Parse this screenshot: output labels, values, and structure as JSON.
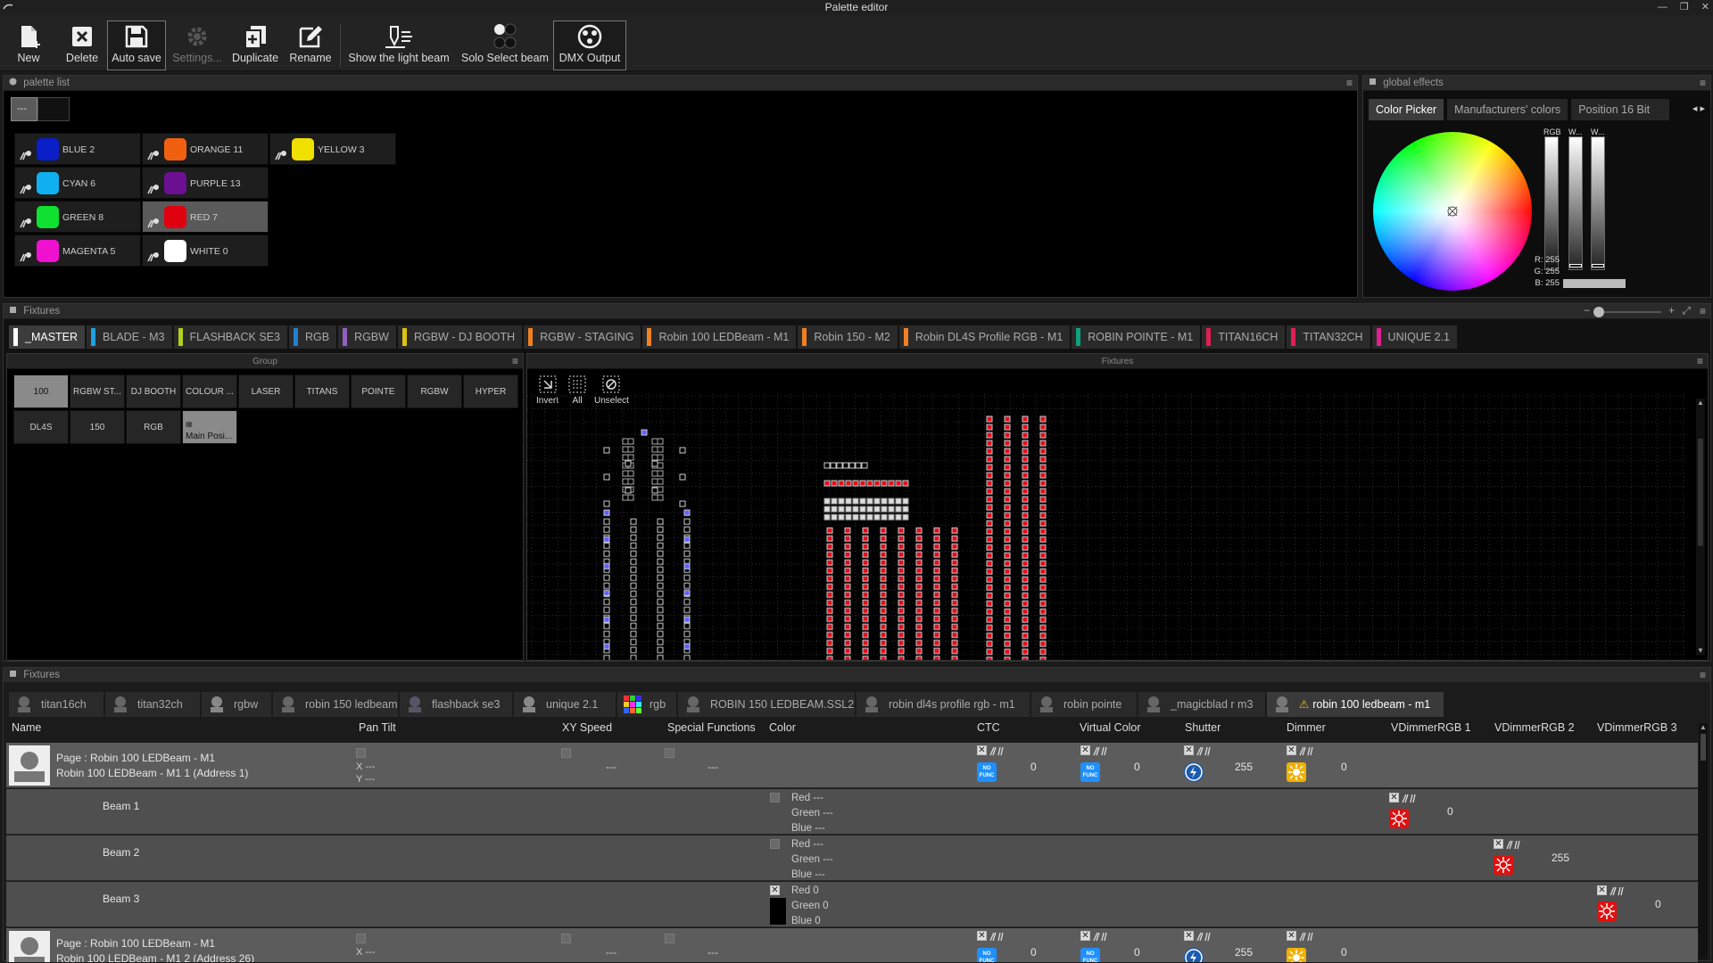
{
  "window": {
    "title": "Palette editor"
  },
  "toolbar": {
    "items": [
      {
        "label": "New"
      },
      {
        "label": "Delete"
      },
      {
        "label": "Auto save"
      },
      {
        "label": "Settings..."
      },
      {
        "label": "Duplicate"
      },
      {
        "label": "Rename"
      },
      {
        "label": "Show the light beam"
      },
      {
        "label": "Solo Select beam"
      },
      {
        "label": "DMX Output"
      }
    ]
  },
  "palette_list": {
    "title": "palette list",
    "tab_label": "---",
    "items": [
      {
        "name": "BLUE 2",
        "color": "#0a1fc8"
      },
      {
        "name": "ORANGE 11",
        "color": "#f06010"
      },
      {
        "name": "YELLOW 3",
        "color": "#f0e000"
      },
      {
        "name": "CYAN 6",
        "color": "#10b0f0"
      },
      {
        "name": "PURPLE 13",
        "color": "#6a1090"
      },
      {
        "name": "GREEN 8",
        "color": "#10e030"
      },
      {
        "name": "RED 7",
        "color": "#e00010"
      },
      {
        "name": "MAGENTA 5",
        "color": "#f010d0"
      },
      {
        "name": "WHITE 0",
        "color": "#ffffff"
      }
    ]
  },
  "global_effects": {
    "title": "global effects",
    "tabs": [
      "Color Picker",
      "Manufacturers' colors",
      "Position 16 Bit"
    ],
    "slider_labels": [
      "RGB",
      "W...",
      "W..."
    ],
    "readout": {
      "r": "R: 255",
      "g": "G: 255",
      "b": "B: 255"
    }
  },
  "fixtures_panel": {
    "title": "Fixtures",
    "tabs": [
      {
        "label": "_MASTER",
        "color": "#ffffff"
      },
      {
        "label": "BLADE - M3",
        "color": "#20a0e0"
      },
      {
        "label": "FLASHBACK SE3",
        "color": "#b0d020"
      },
      {
        "label": "RGB",
        "color": "#2080d0"
      },
      {
        "label": "RGBW",
        "color": "#9060c0"
      },
      {
        "label": "RGBW - DJ BOOTH",
        "color": "#e0c010"
      },
      {
        "label": "RGBW - STAGING",
        "color": "#f08020"
      },
      {
        "label": "Robin 100 LEDBeam - M1",
        "color": "#f08020"
      },
      {
        "label": "Robin 150 - M2",
        "color": "#f08020"
      },
      {
        "label": "Robin DL4S Profile RGB - M1",
        "color": "#f08020"
      },
      {
        "label": "ROBIN POINTE - M1",
        "color": "#10a080"
      },
      {
        "label": "TITAN16CH",
        "color": "#e02050"
      },
      {
        "label": "TITAN32CH",
        "color": "#e02050"
      },
      {
        "label": "UNIQUE 2.1",
        "color": "#e02090"
      }
    ],
    "group_title": "Group",
    "groups": [
      "100",
      "RGBW ST...",
      "DJ BOOTH",
      "COLOUR ...",
      "LASER",
      "TITANS",
      "POINTE",
      "RGBW",
      "HYPER",
      "DL4S",
      "150",
      "RGB",
      "Main Posi..."
    ],
    "fixtures_title": "Fixtures",
    "grid_tools": [
      "Invert",
      "All",
      "Unselect"
    ]
  },
  "sheet": {
    "title": "Fixtures",
    "tabs": [
      "titan16ch",
      "titan32ch",
      "rgbw",
      "robin 150 ledbeam",
      "flashback se3",
      "unique 2.1",
      "rgb",
      "ROBIN 150 LEDBEAM.SSL2",
      "robin dl4s profile rgb - m1",
      "robin pointe",
      "_magicblad r m3",
      "robin 100 ledbeam - m1"
    ],
    "columns": [
      "Name",
      "Pan Tilt",
      "XY Speed",
      "Special Functions",
      "Color",
      "CTC",
      "Virtual Color",
      "Shutter",
      "Dimmer",
      "VDimmerRGB 1",
      "VDimmerRGB 2",
      "VDimmerRGB 3"
    ],
    "rows": [
      {
        "line1": "Page : Robin 100 LEDBeam - M1",
        "line2": "Robin 100 LEDBeam - M1  1 (Address 1)",
        "x": "X ---",
        "y": "Y ---",
        "xy": "---",
        "sf": "---",
        "ctc": "0",
        "vc": "0",
        "shutter": "255",
        "dimmer": "0"
      },
      {
        "beam": "Beam 1",
        "red": "Red ---",
        "green": "Green ---",
        "blue": "Blue ---",
        "v": "0"
      },
      {
        "beam": "Beam 2",
        "red": "Red ---",
        "green": "Green ---",
        "blue": "Blue ---",
        "v": "255"
      },
      {
        "beam": "Beam 3",
        "red": "Red 0",
        "green": "Green 0",
        "blue": "Blue 0",
        "v": "0"
      },
      {
        "line1": "Page : Robin 100 LEDBeam - M1",
        "line2": "Robin 100 LEDBeam - M1  2 (Address 26)",
        "x": "X ---",
        "xy": "---",
        "sf": "---",
        "ctc": "0",
        "vc": "0",
        "shutter": "255",
        "dimmer": "0"
      }
    ],
    "nofunc": "NO FUNC"
  }
}
